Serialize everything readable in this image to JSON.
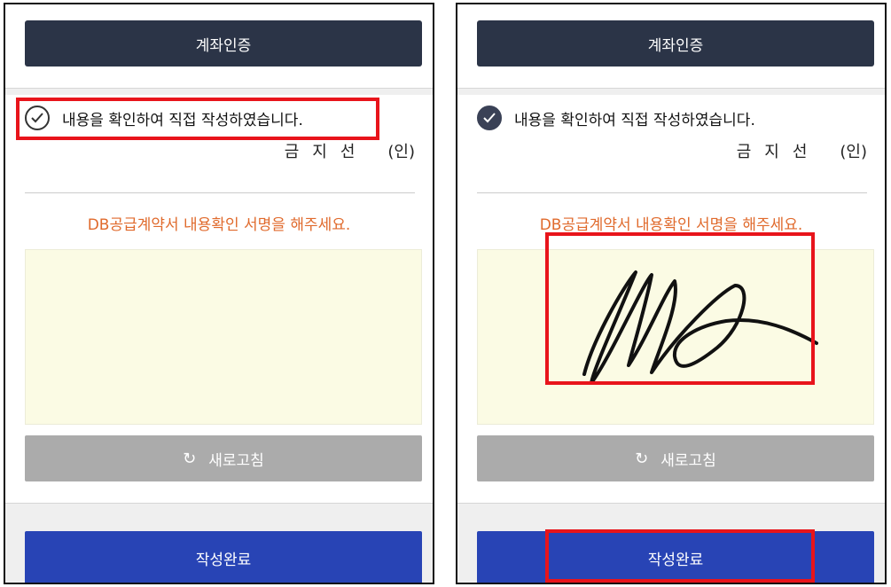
{
  "left": {
    "account_auth_label": "계좌인증",
    "confirm_text": "내용을 확인하여 직접 작성하였습니다.",
    "signer_name": "금지선",
    "seal_text": "(인)",
    "instruction": "DB공급계약서 내용확인 서명을 해주세요.",
    "refresh_label": "새로고침",
    "complete_label": "작성완료",
    "checkbox_state": "unchecked"
  },
  "right": {
    "account_auth_label": "계좌인증",
    "confirm_text": "내용을 확인하여 직접 작성하였습니다.",
    "signer_name": "금지선",
    "seal_text": "(인)",
    "instruction": "DB공급계약서 내용확인 서명을 해주세요.",
    "refresh_label": "새로고침",
    "complete_label": "작성완료",
    "checkbox_state": "checked",
    "signature_present": true
  },
  "colors": {
    "top_button": "#2b3447",
    "instruction": "#e06a2c",
    "signature_pad": "#fbfbe4",
    "refresh_button": "#ababab",
    "complete_button": "#2844b5",
    "highlight": "#e8141b"
  },
  "icons": {
    "check": "check-circle-icon",
    "refresh": "refresh-icon"
  }
}
